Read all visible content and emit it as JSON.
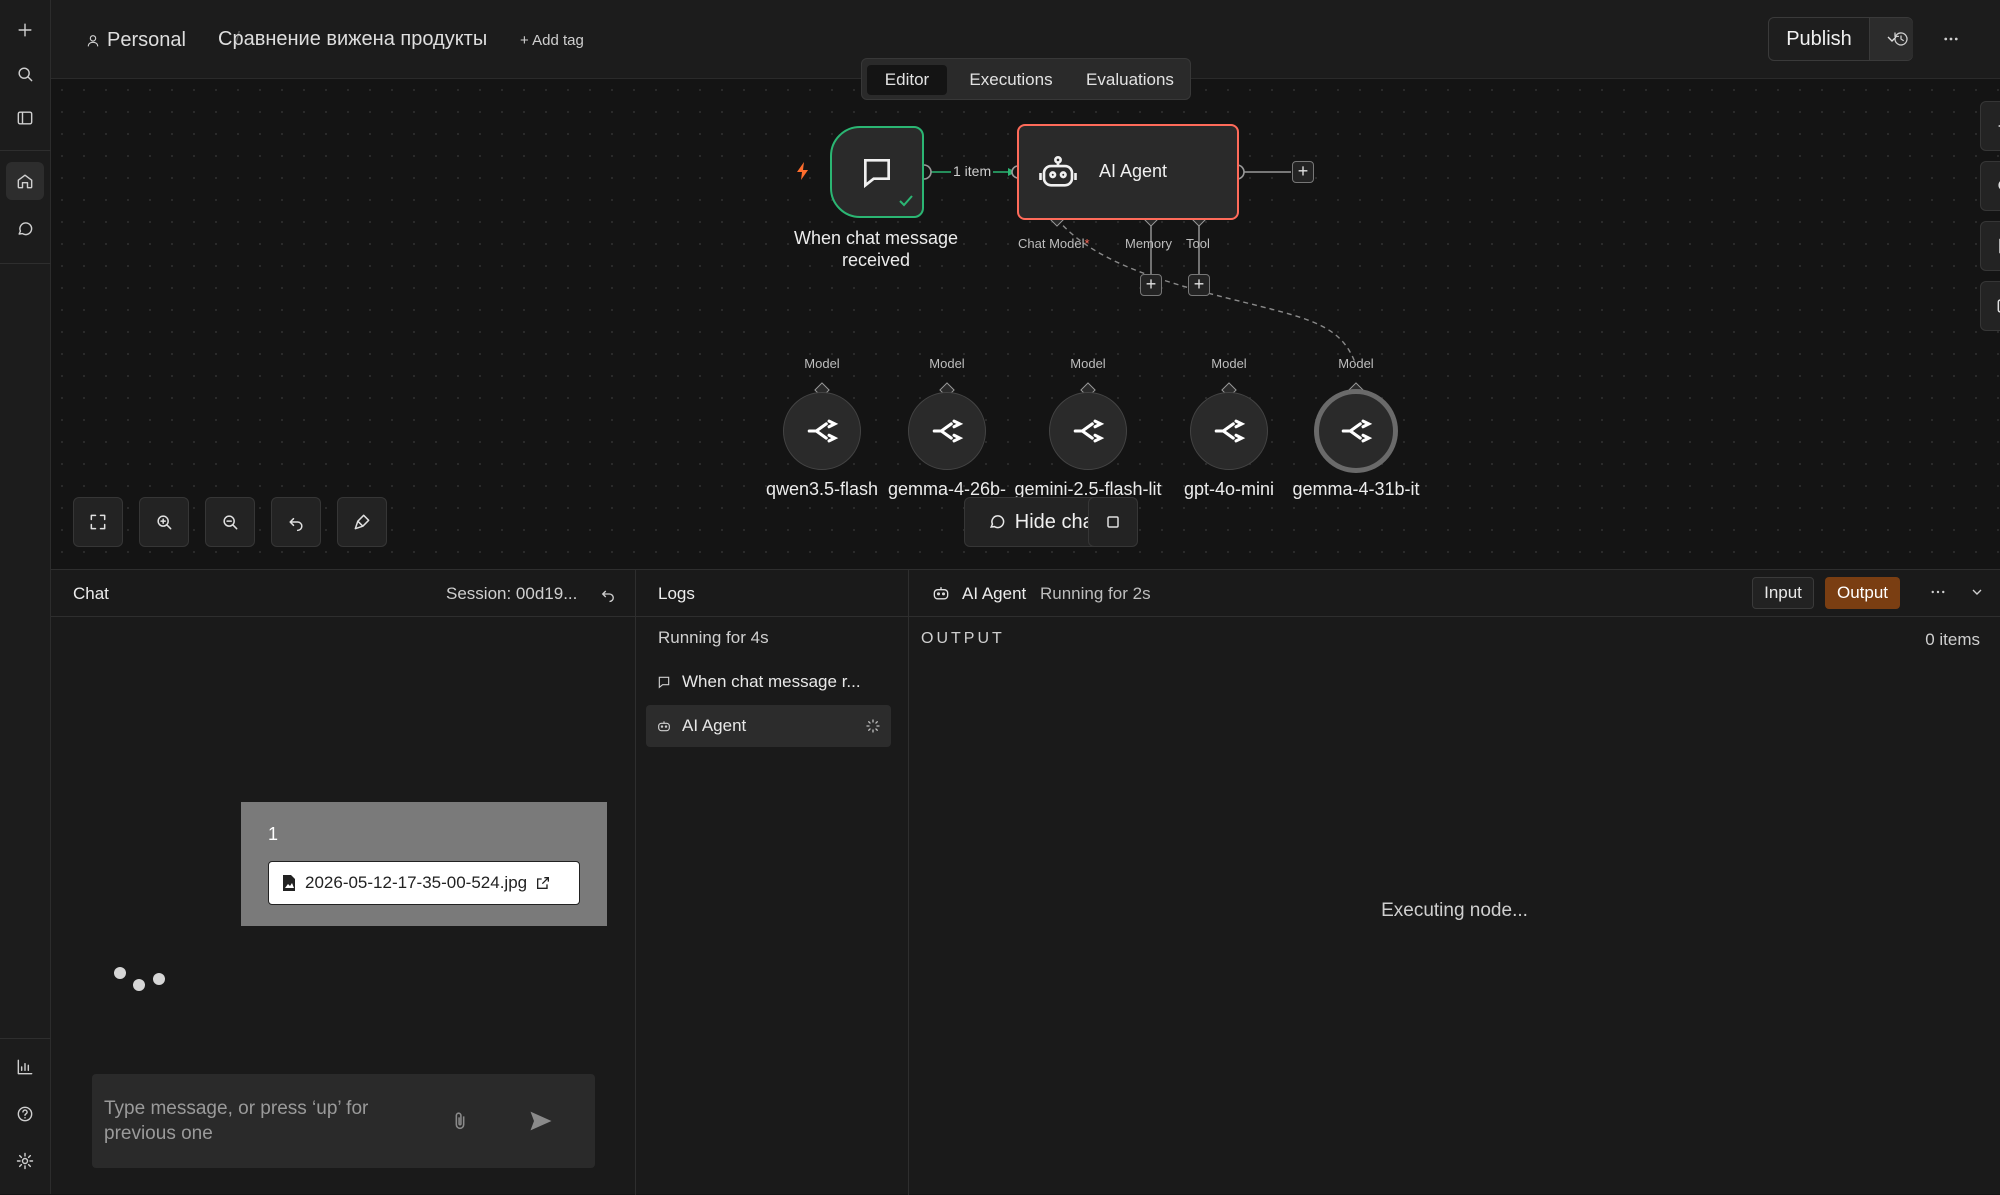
{
  "topbar": {
    "project": "Personal",
    "workflow_name": "Сравнение вижена продукты",
    "add_tag": "+ Add tag",
    "publish_label": "Publish"
  },
  "tabs": [
    "Editor",
    "Executions",
    "Evaluations"
  ],
  "canvas": {
    "trigger_node": {
      "label": "When chat message received"
    },
    "connection_label": "1 item",
    "agent_node": {
      "label": "AI Agent"
    },
    "agent_inputs": {
      "chat_model": "Chat Model",
      "required_mark": "*",
      "memory": "Memory",
      "tool": "Tool"
    },
    "model_port_label": "Model",
    "models": [
      {
        "label": "qwen3.5-flash"
      },
      {
        "label": "gemma-4-26b-"
      },
      {
        "label": "gemini-2.5-flash-lit"
      },
      {
        "label": "gpt-4o-mini"
      },
      {
        "label": "gemma-4-31b-it"
      }
    ],
    "hide_chat": "Hide chat"
  },
  "chat": {
    "title": "Chat",
    "session": "Session: 00d19...",
    "message_text": "1",
    "attachment": "2026-05-12-17-35-00-524.jpg",
    "input_placeholder": "Type message, or press ‘up’ for previous one"
  },
  "logs": {
    "title": "Logs",
    "running": "Running for 4s",
    "items": [
      {
        "label": "When chat message r..."
      },
      {
        "label": "AI Agent"
      }
    ]
  },
  "output": {
    "node_name": "AI Agent",
    "running": "Running for 2s",
    "input_btn": "Input",
    "output_btn": "Output",
    "section": "OUTPUT",
    "items_count": "0 items",
    "status": "Executing node..."
  },
  "colors": {
    "trigger_border": "#2bb673",
    "agent_border": "#ff6b5a",
    "output_active": "#7a3e12",
    "bolt": "#ff6d2d"
  }
}
